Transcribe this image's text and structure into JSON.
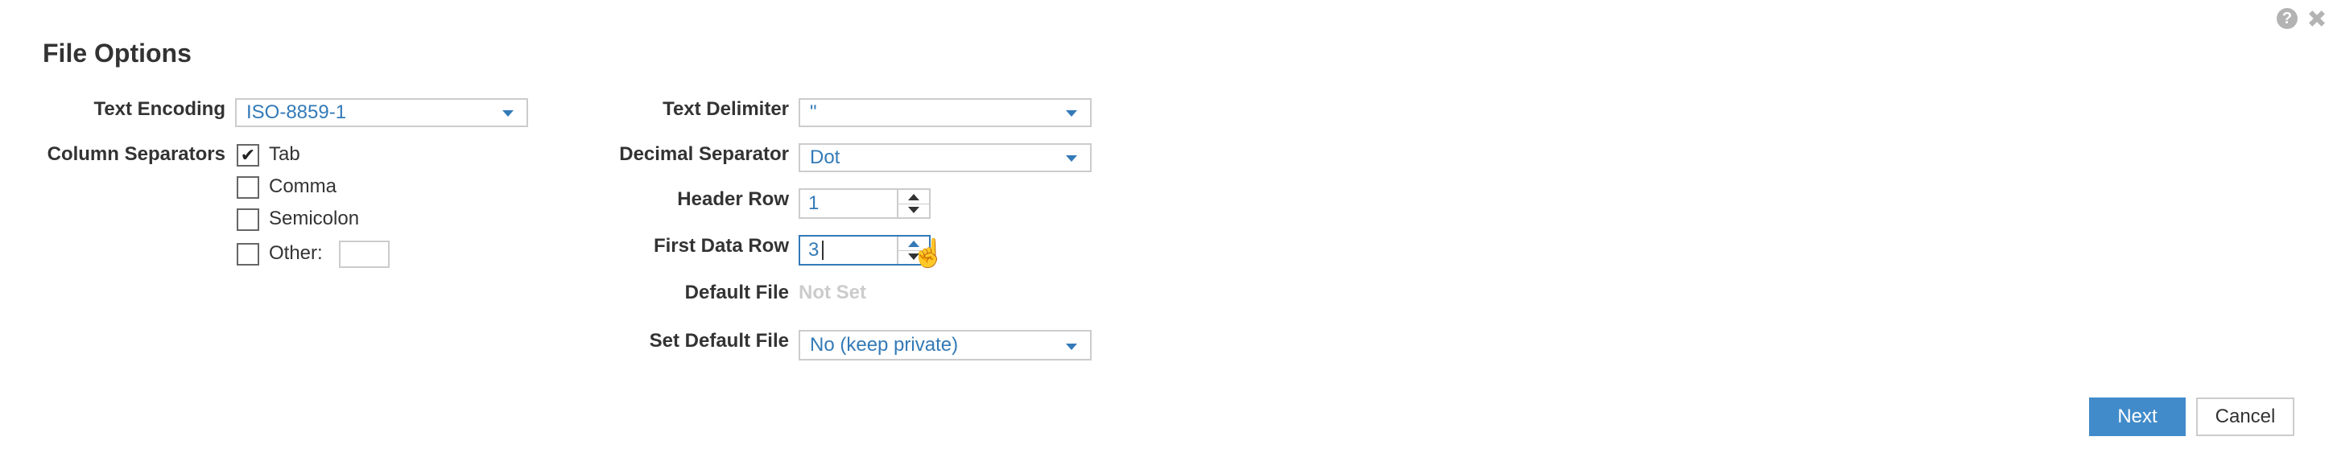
{
  "dialog": {
    "title": "File Options",
    "icons": {
      "help": "help-icon",
      "close": "close-icon"
    },
    "help_glyph": "?"
  },
  "left_column": {
    "text_encoding": {
      "label": "Text Encoding",
      "value": "ISO-8859-1"
    },
    "column_separators": {
      "label": "Column Separators",
      "options": [
        {
          "label": "Tab",
          "checked": true
        },
        {
          "label": "Comma",
          "checked": false
        },
        {
          "label": "Semicolon",
          "checked": false
        },
        {
          "label": "Other:",
          "checked": false,
          "value": ""
        }
      ],
      "check_glyph": "✔"
    }
  },
  "right_column": {
    "text_delimiter": {
      "label": "Text Delimiter",
      "value": "\""
    },
    "decimal_separator": {
      "label": "Decimal Separator",
      "value": "Dot"
    },
    "header_row": {
      "label": "Header Row",
      "value": "1"
    },
    "first_data_row": {
      "label": "First Data Row",
      "value": "3"
    },
    "default_file": {
      "label": "Default File",
      "value": "Not Set"
    },
    "set_default_file": {
      "label": "Set Default File",
      "value": "No (keep private)"
    }
  },
  "footer": {
    "next_label": "Next",
    "cancel_label": "Cancel"
  },
  "colors": {
    "accent": "#337ab7",
    "primary_button": "#428bca",
    "muted_text": "#cccccc"
  },
  "cursor": {
    "glyph": "☝"
  }
}
